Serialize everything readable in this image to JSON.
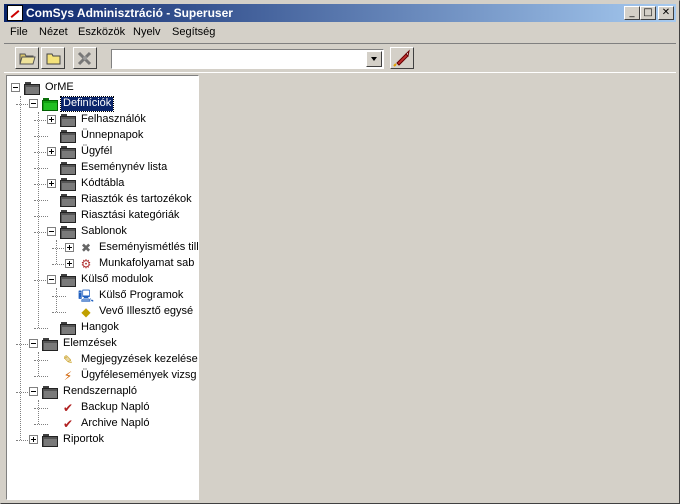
{
  "window": {
    "title": "ComSys Adminisztráció - Superuser"
  },
  "titlebar_buttons": {
    "minimize": "_",
    "maximize": "□",
    "close": "✕"
  },
  "menu": [
    "File",
    "Nézet",
    "Eszközök",
    "Nyelv",
    "Segítség"
  ],
  "toolbar": {
    "buttons": [
      "open-icon",
      "folder-icon",
      "tools-icon",
      "rocket-icon"
    ],
    "combo": {
      "value": ""
    }
  },
  "tree": [
    {
      "label": "OrME",
      "icon": "folder-icon",
      "expander": "minus"
    },
    {
      "label": "Definíciók",
      "icon": "folder-green-icon",
      "expander": "minus",
      "selected": true
    },
    {
      "label": "Felhasználók",
      "icon": "folder-icon",
      "expander": "plus"
    },
    {
      "label": "Ünnepnapok",
      "icon": "folder-icon"
    },
    {
      "label": "Ügyfél",
      "icon": "folder-icon",
      "expander": "plus"
    },
    {
      "label": "Eseménynév lista",
      "icon": "folder-icon"
    },
    {
      "label": "Kódtábla",
      "icon": "folder-icon",
      "expander": "plus"
    },
    {
      "label": "Riasztók és tartozékok",
      "icon": "folder-icon"
    },
    {
      "label": "Riasztási kategóriák",
      "icon": "folder-icon"
    },
    {
      "label": "Sablonok",
      "icon": "folder-icon",
      "expander": "minus"
    },
    {
      "label": "Eseményismétlés till",
      "icon": "tools-icon",
      "expander": "plus"
    },
    {
      "label": "Munkafolyamat sab",
      "icon": "workflow-icon",
      "expander": "plus"
    },
    {
      "label": "Külső modulok",
      "icon": "folder-icon",
      "expander": "minus"
    },
    {
      "label": "Külső Programok",
      "icon": "program-icon"
    },
    {
      "label": "Vevő Illesztő egysé",
      "icon": "receiver-icon"
    },
    {
      "label": "Hangok",
      "icon": "folder-icon"
    },
    {
      "label": "Elemzések",
      "icon": "folder-icon",
      "expander": "minus"
    },
    {
      "label": "Megjegyzések kezelése",
      "icon": "notes-icon"
    },
    {
      "label": "Ügyfélesemények vizsg",
      "icon": "events-icon"
    },
    {
      "label": "Rendszernapló",
      "icon": "folder-icon",
      "expander": "minus"
    },
    {
      "label": "Backup Napló",
      "icon": "log-icon"
    },
    {
      "label": "Archive Napló",
      "icon": "log-icon"
    },
    {
      "label": "Riportok",
      "icon": "folder-icon",
      "expander": "plus"
    }
  ]
}
